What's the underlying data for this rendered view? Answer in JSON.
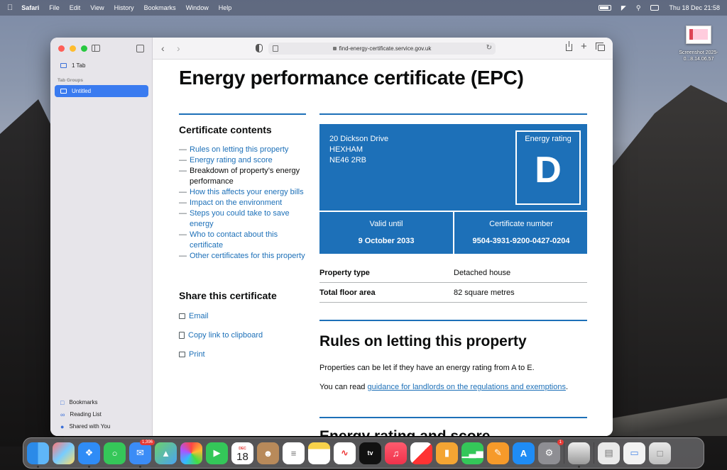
{
  "menubar": {
    "app": "Safari",
    "items": [
      "File",
      "Edit",
      "View",
      "History",
      "Bookmarks",
      "Window",
      "Help"
    ],
    "clock": "Thu 18 Dec  21:58"
  },
  "desktop": {
    "icon_label": "Screenshot 2025-0...8.14.06.57"
  },
  "sidebar": {
    "tab_count": "1 Tab",
    "tab_groups_heading": "Tab Groups",
    "tab_group": "Untitled",
    "bookmarks": "Bookmarks",
    "reading_list": "Reading List",
    "shared": "Shared with You"
  },
  "toolbar": {
    "url": "find-energy-certificate.service.gov.uk"
  },
  "page": {
    "title": "Energy performance certificate (EPC)",
    "contents_title": "Certificate contents",
    "contents": [
      "Rules on letting this property",
      "Energy rating and score",
      "Breakdown of property’s energy performance",
      "How this affects your energy bills",
      "Impact on the environment",
      "Steps you could take to save energy",
      "Who to contact about this certificate",
      "Other certificates for this property"
    ],
    "share_title": "Share this certificate",
    "share_email": "Email",
    "share_copy": "Copy link to clipboard",
    "share_print": "Print",
    "address_line1": "20 Dickson Drive",
    "address_line2": "HEXHAM",
    "address_line3": "NE46 2RB",
    "rating_label": "Energy rating",
    "rating_value": "D",
    "valid_label": "Valid until",
    "valid_value": "9 October 2033",
    "cert_label": "Certificate number",
    "cert_value": "9504-3931-9200-0427-0204",
    "property_type_label": "Property type",
    "property_type_value": "Detached house",
    "floor_area_label": "Total floor area",
    "floor_area_value": "82 square metres",
    "rules_heading": "Rules on letting this property",
    "rules_para1": "Properties can be let if they have an energy rating from A to E.",
    "rules_para2_prefix": "You can read ",
    "rules_para2_link": "guidance for landlords on the regulations and exemptions",
    "rules_para2_suffix": ".",
    "next_heading": "Energy rating and score"
  },
  "dock": {
    "mail_badge": "1,396",
    "calendar_month": "DEC",
    "calendar_day": "18",
    "settings_badge": "1"
  },
  "colors": {
    "gov_blue": "#1d70b8",
    "safari_selected": "#3a7bf0"
  }
}
